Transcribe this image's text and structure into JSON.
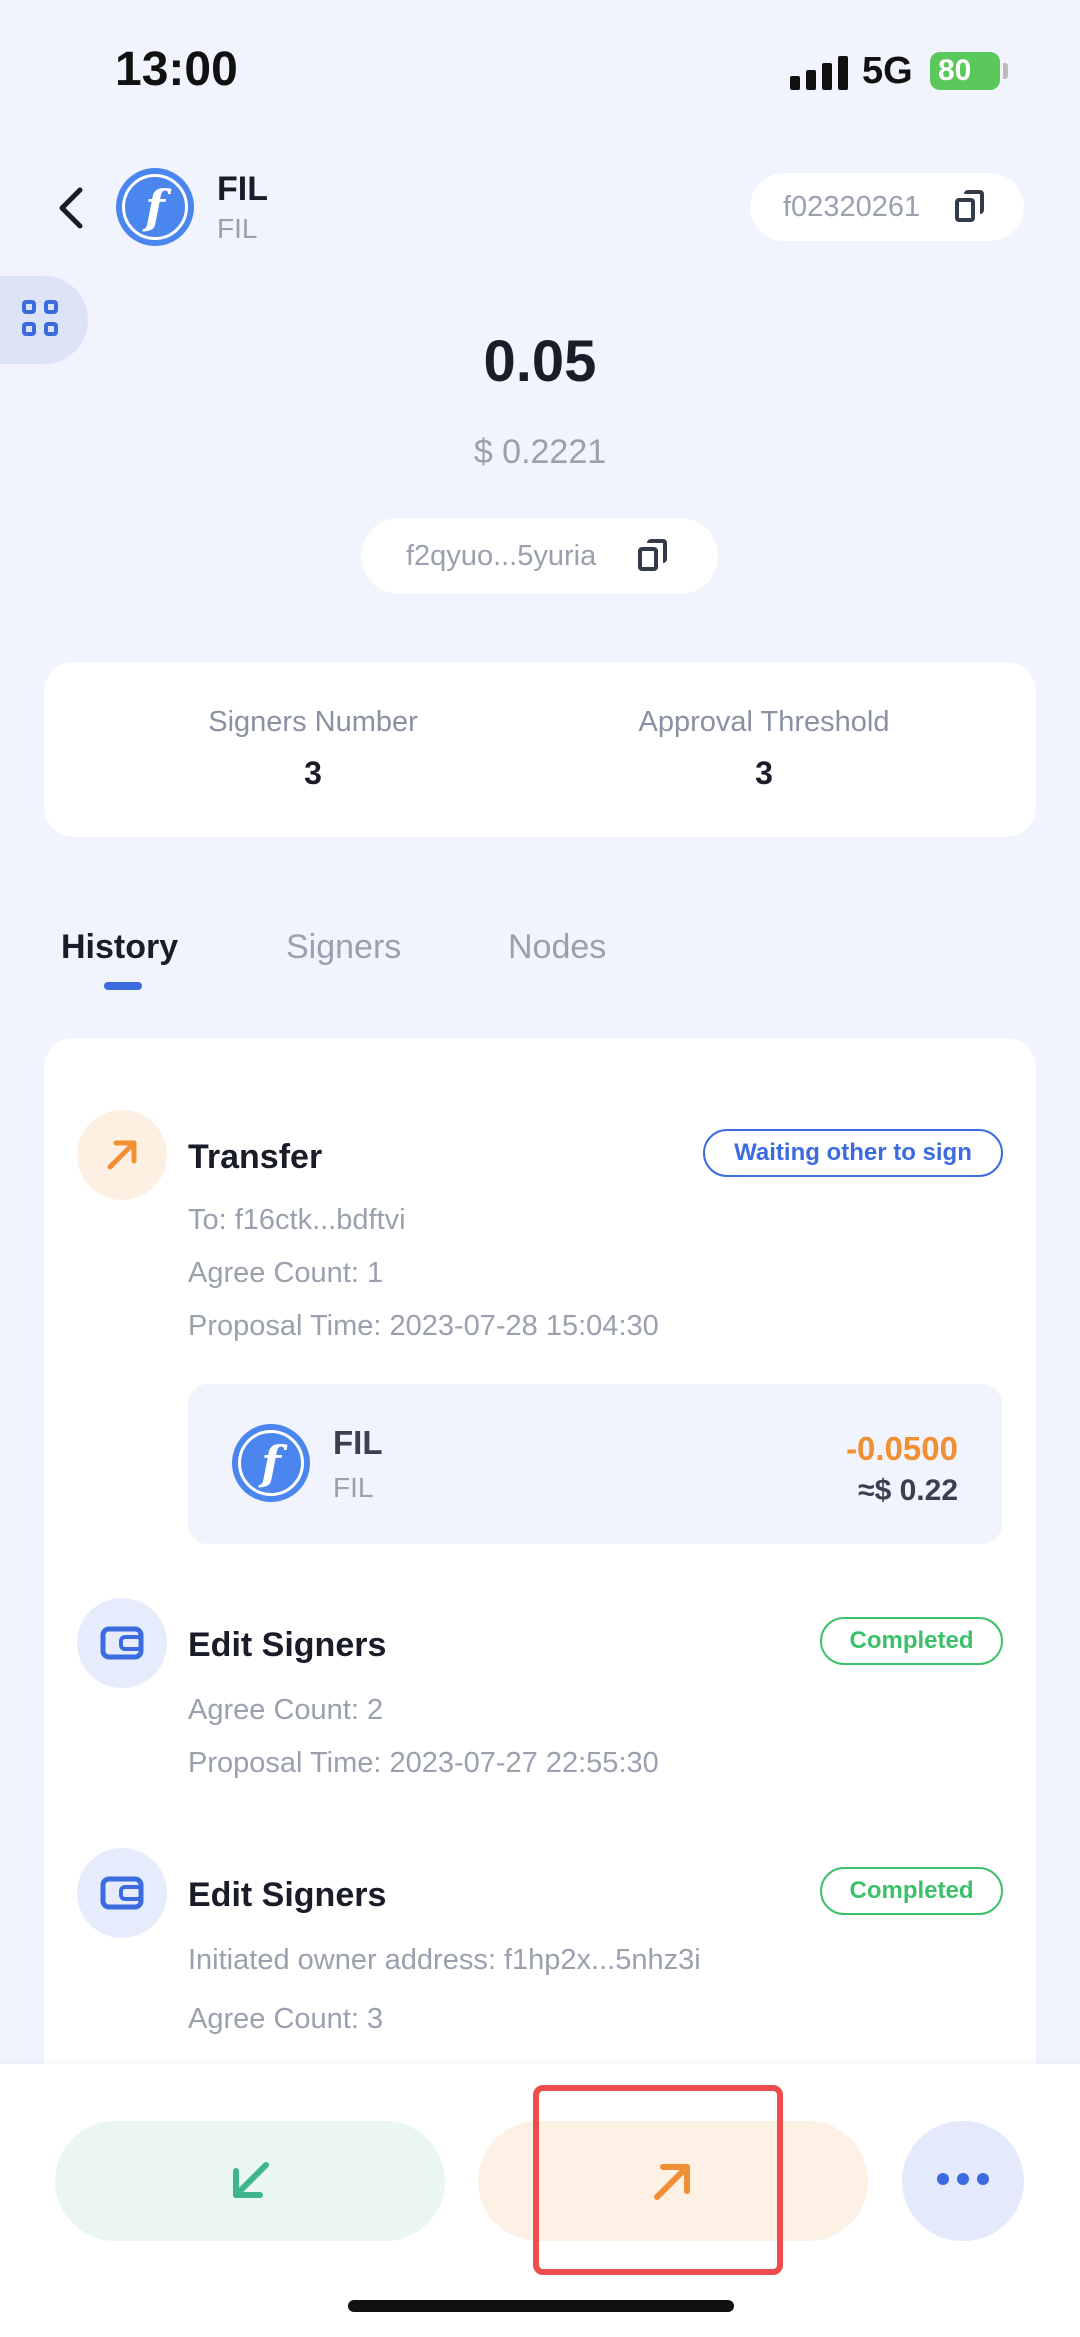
{
  "status_bar": {
    "time": "13:00",
    "network": "5G",
    "battery": "80"
  },
  "header": {
    "coin_name": "FIL",
    "coin_symbol": "FIL",
    "account_id": "f02320261"
  },
  "balance": {
    "amount": "0.05",
    "fiat": "$ 0.2221",
    "address": "f2qyuo...5yuria"
  },
  "stats": {
    "signers_label": "Signers Number",
    "signers_value": "3",
    "threshold_label": "Approval Threshold",
    "threshold_value": "3"
  },
  "tabs": [
    {
      "label": "History",
      "active": true
    },
    {
      "label": "Signers",
      "active": false
    },
    {
      "label": "Nodes",
      "active": false
    }
  ],
  "history": [
    {
      "title": "Transfer",
      "status": "Waiting other to sign",
      "details": [
        "To: f16ctk...bdftvi",
        "Agree Count: 1",
        "Proposal Time: 2023-07-28 15:04:30"
      ],
      "asset": {
        "name": "FIL",
        "symbol": "FIL",
        "amount": "-0.0500",
        "fiat": "≈$ 0.22"
      }
    },
    {
      "title": "Edit Signers",
      "status": "Completed",
      "details": [
        "Agree Count: 2",
        "Proposal Time: 2023-07-27 22:55:30"
      ]
    },
    {
      "title": "Edit Signers",
      "status": "Completed",
      "details": [
        "Initiated owner address: f1hp2x...5nhz3i",
        "Agree Count: 3"
      ]
    }
  ],
  "icons": {
    "back": "chevron-left-icon",
    "copy": "copy-icon",
    "apps": "grid-icon",
    "send": "arrow-up-right-icon",
    "receive": "arrow-down-left-icon",
    "wallet": "wallet-icon",
    "more": "more-dots-icon"
  },
  "colors": {
    "accent": "#3C6BE0",
    "send": "#F08F34",
    "receive": "#3FB58E",
    "completed": "#3CC06A",
    "highlight": "#EC4D4D"
  }
}
